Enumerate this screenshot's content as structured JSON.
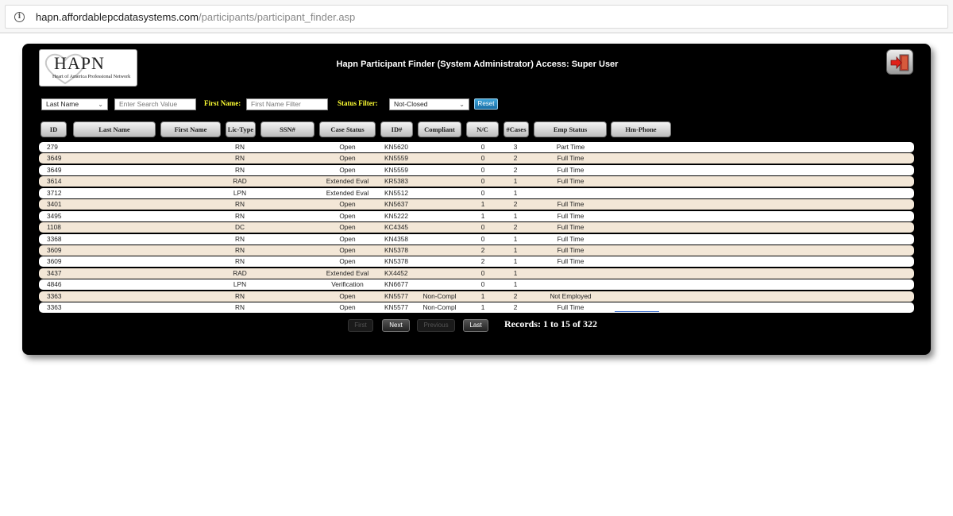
{
  "browser": {
    "url_host": "hapn.affordablepcdatasystems.com",
    "url_path": "/participants/participant_finder.asp"
  },
  "logo": {
    "title": "HAPN",
    "subtitle": "Heart of America Professional Network"
  },
  "header": {
    "title": "Hapn Participant Finder (System Administrator) Access: Super User"
  },
  "filters": {
    "search_by_value": "Last Name",
    "search_placeholder": "Enter Search Value",
    "first_name_label": "First Name:",
    "first_name_placeholder": "First Name Filter",
    "status_label": "Status Filter:",
    "status_value": "Not-Closed",
    "reset_label": "Reset"
  },
  "columns": [
    "ID",
    "Last Name",
    "First Name",
    "Lic-Type",
    "SSN#",
    "Case Status",
    "ID#",
    "Compliant",
    "N/C",
    "#Cases",
    "Emp Status",
    "Hm-Phone"
  ],
  "rows": [
    {
      "id": "279",
      "lic": "RN",
      "case": "Open",
      "idn": "KN5620",
      "comp": "",
      "nc": "0",
      "cases": "3",
      "emp": "Part Time"
    },
    {
      "id": "3649",
      "lic": "RN",
      "case": "Open",
      "idn": "KN5559",
      "comp": "",
      "nc": "0",
      "cases": "2",
      "emp": "Full Time"
    },
    {
      "id": "3649",
      "lic": "RN",
      "case": "Open",
      "idn": "KN5559",
      "comp": "",
      "nc": "0",
      "cases": "2",
      "emp": "Full Time"
    },
    {
      "id": "3614",
      "lic": "RAD",
      "case": "Extended Eval",
      "idn": "KR5383",
      "comp": "",
      "nc": "0",
      "cases": "1",
      "emp": "Full Time"
    },
    {
      "id": "3712",
      "lic": "LPN",
      "case": "Extended Eval",
      "idn": "KN5512",
      "comp": "",
      "nc": "0",
      "cases": "1",
      "emp": ""
    },
    {
      "id": "3401",
      "lic": "RN",
      "case": "Open",
      "idn": "KN5637",
      "comp": "",
      "nc": "1",
      "cases": "2",
      "emp": "Full Time"
    },
    {
      "id": "3495",
      "lic": "RN",
      "case": "Open",
      "idn": "KN5222",
      "comp": "",
      "nc": "1",
      "cases": "1",
      "emp": "Full Time"
    },
    {
      "id": "1108",
      "lic": "DC",
      "case": "Open",
      "idn": "KC4345",
      "comp": "",
      "nc": "0",
      "cases": "2",
      "emp": "Full Time"
    },
    {
      "id": "3368",
      "lic": "RN",
      "case": "Open",
      "idn": "KN4358",
      "comp": "",
      "nc": "0",
      "cases": "1",
      "emp": "Full Time"
    },
    {
      "id": "3609",
      "lic": "RN",
      "case": "Open",
      "idn": "KN5378",
      "comp": "",
      "nc": "2",
      "cases": "1",
      "emp": "Full Time"
    },
    {
      "id": "3609",
      "lic": "RN",
      "case": "Open",
      "idn": "KN5378",
      "comp": "",
      "nc": "2",
      "cases": "1",
      "emp": "Full Time"
    },
    {
      "id": "3437",
      "lic": "RAD",
      "case": "Extended Eval",
      "idn": "KX4452",
      "comp": "",
      "nc": "0",
      "cases": "1",
      "emp": ""
    },
    {
      "id": "4846",
      "lic": "LPN",
      "case": "Verification",
      "idn": "KN6677",
      "comp": "",
      "nc": "0",
      "cases": "1",
      "emp": ""
    },
    {
      "id": "3363",
      "lic": "RN",
      "case": "Open",
      "idn": "KN5577",
      "comp": "Non-Compl",
      "nc": "1",
      "cases": "2",
      "emp": "Not Employed"
    },
    {
      "id": "3363",
      "lic": "RN",
      "case": "Open",
      "idn": "KN5577",
      "comp": "Non-Compl",
      "nc": "1",
      "cases": "2",
      "emp": "Full Time"
    }
  ],
  "pager": {
    "first": "First",
    "next": "Next",
    "previous": "Previous",
    "last": "Last",
    "records": "Records: 1 to 15 of 322"
  },
  "colors": {
    "panel": "#000000",
    "row_alt": "#f3e7d7",
    "label_yellow": "#ffff33",
    "reset_blue": "#1f84c0"
  }
}
